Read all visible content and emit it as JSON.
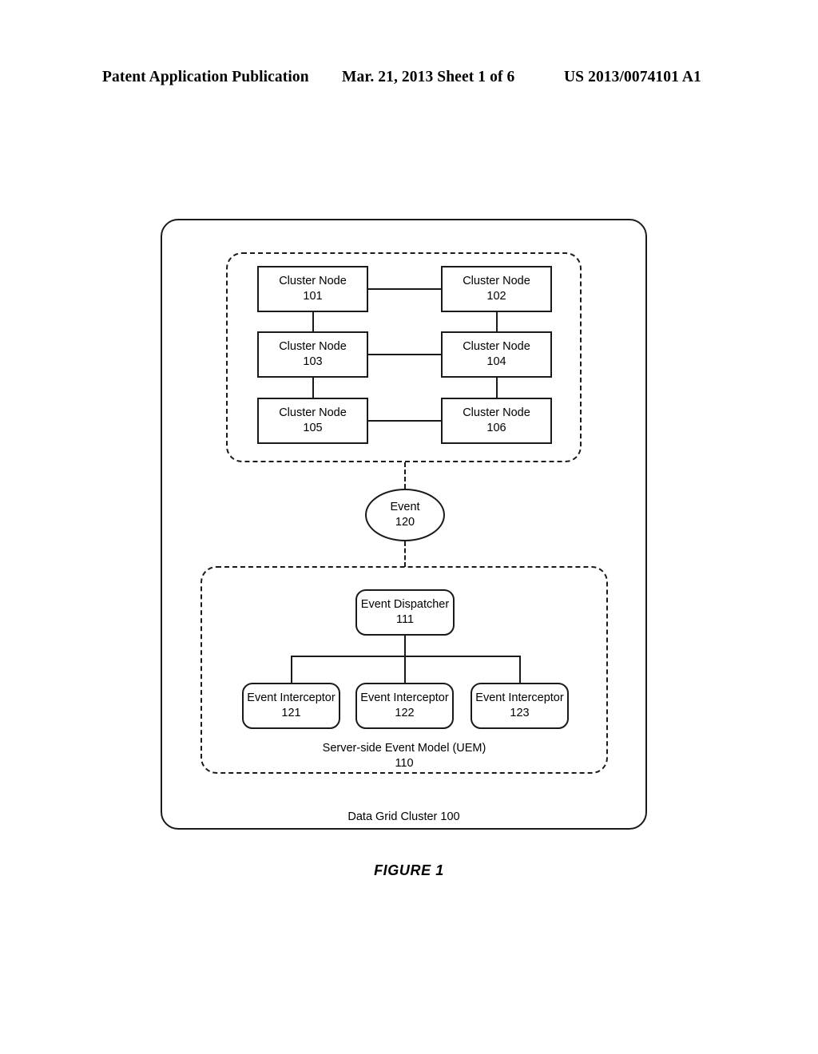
{
  "header": {
    "publication": "Patent Application Publication",
    "date_sheet": "Mar. 21, 2013  Sheet 1 of 6",
    "patent_number": "US 2013/0074101 A1"
  },
  "figure": {
    "caption": "FIGURE 1",
    "outer_container": {
      "label": "Data Grid Cluster 100"
    },
    "cluster_nodes": [
      {
        "label": "Cluster Node",
        "ref": "101"
      },
      {
        "label": "Cluster Node",
        "ref": "102"
      },
      {
        "label": "Cluster Node",
        "ref": "103"
      },
      {
        "label": "Cluster Node",
        "ref": "104"
      },
      {
        "label": "Cluster Node",
        "ref": "105"
      },
      {
        "label": "Cluster Node",
        "ref": "106"
      }
    ],
    "event": {
      "label": "Event",
      "ref": "120"
    },
    "uem": {
      "label": "Server-side Event Model (UEM)",
      "ref": "110",
      "dispatcher": {
        "label": "Event Dispatcher",
        "ref": "111"
      },
      "interceptors": [
        {
          "label": "Event Interceptor",
          "ref": "121"
        },
        {
          "label": "Event Interceptor",
          "ref": "122"
        },
        {
          "label": "Event Interceptor",
          "ref": "123"
        }
      ]
    }
  },
  "colors": {
    "line": "#1a1a1a",
    "background": "#ffffff"
  }
}
